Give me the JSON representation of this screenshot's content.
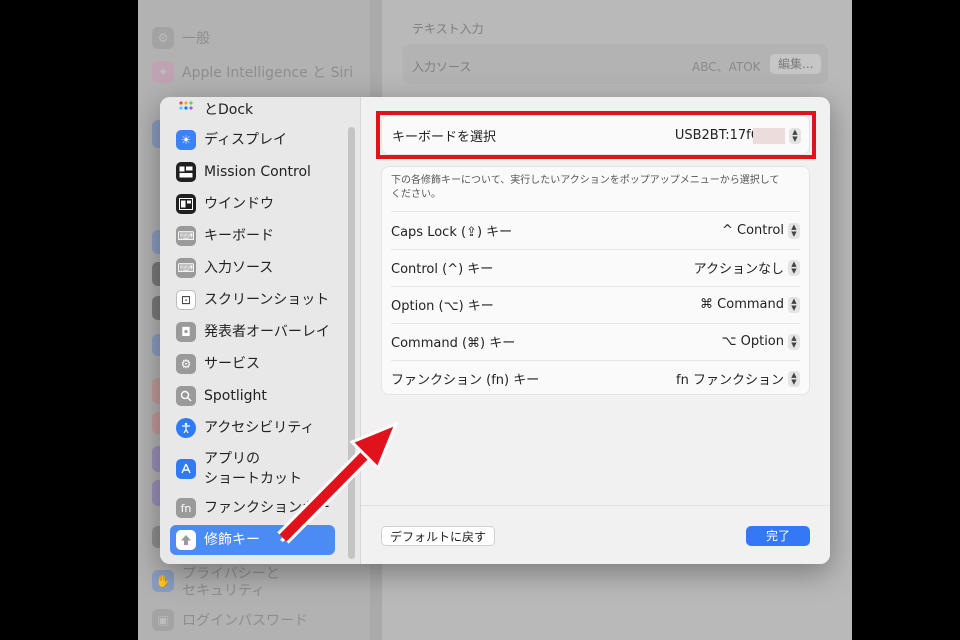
{
  "background_window": {
    "sidebar_items": [
      {
        "label": "一般",
        "icon": "gear-icon"
      },
      {
        "label": "Apple Intelligence と Siri",
        "icon": "siri-icon"
      },
      {
        "label": "プライバシーと",
        "label2": "セキュリティ",
        "icon": "hand-icon"
      },
      {
        "label": "ログインパスワード",
        "icon": "lock-icon"
      }
    ],
    "section_title": "テキスト入力",
    "row_label": "入力ソース",
    "row_value": "ABC、ATOK",
    "row_button": "編集..."
  },
  "dialog": {
    "sidebar_items": [
      {
        "label": "とDock",
        "icon": "dock-icon",
        "color": "#2b2b2b"
      },
      {
        "label": "ディスプレイ",
        "icon": "sun-icon",
        "color": "#3b82f6"
      },
      {
        "label": "Mission Control",
        "icon": "mission-control-icon",
        "color": "#1f1f1f"
      },
      {
        "label": "ウインドウ",
        "icon": "window-icon",
        "color": "#1f1f1f"
      },
      {
        "label": "キーボード",
        "icon": "keyboard-icon",
        "color": "#9a9a9a"
      },
      {
        "label": "入力ソース",
        "icon": "keyboard-icon",
        "color": "#9a9a9a"
      },
      {
        "label": "スクリーンショット",
        "icon": "screenshot-icon",
        "color": "#ffffff"
      },
      {
        "label": "発表者オーバーレイ",
        "icon": "presenter-icon",
        "color": "#9a9a9a"
      },
      {
        "label": "サービス",
        "icon": "services-gear-icon",
        "color": "#9a9a9a"
      },
      {
        "label": "Spotlight",
        "icon": "magnifier-icon",
        "color": "#9a9a9a"
      },
      {
        "label": "アクセシビリティ",
        "icon": "accessibility-icon",
        "color": "#2f7bf5"
      },
      {
        "label": "アプリの",
        "label2": "ショートカット",
        "icon": "app-store-icon",
        "color": "#2f7bf5"
      },
      {
        "label": "ファンクションキー",
        "icon": "fn-icon",
        "color": "#9a9a9a"
      },
      {
        "label": "修飾キー",
        "icon": "modifier-up-icon",
        "color": "#ffffff"
      }
    ],
    "keyboard_select": {
      "label": "キーボードを選択",
      "value": "USB2BT:17f6"
    },
    "description": "下の各修飾キーについて、実行したいアクションをポップアップメニューから選択してください。",
    "modifier_rows": [
      {
        "label": "Caps Lock (⇪) キー",
        "value": "^ Control"
      },
      {
        "label": "Control (^) キー",
        "value": "アクションなし"
      },
      {
        "label": "Option (⌥) キー",
        "value": "⌘ Command"
      },
      {
        "label": "Command (⌘) キー",
        "value": "⌥ Option"
      },
      {
        "label": "ファンクション (fn) キー",
        "value": "fn ファンクション"
      }
    ],
    "default_button": "デフォルトに戻す",
    "done_button": "完了"
  },
  "colors": {
    "highlight": "#e0131d",
    "accent": "#3478f6",
    "selected": "#4b8bf4"
  }
}
